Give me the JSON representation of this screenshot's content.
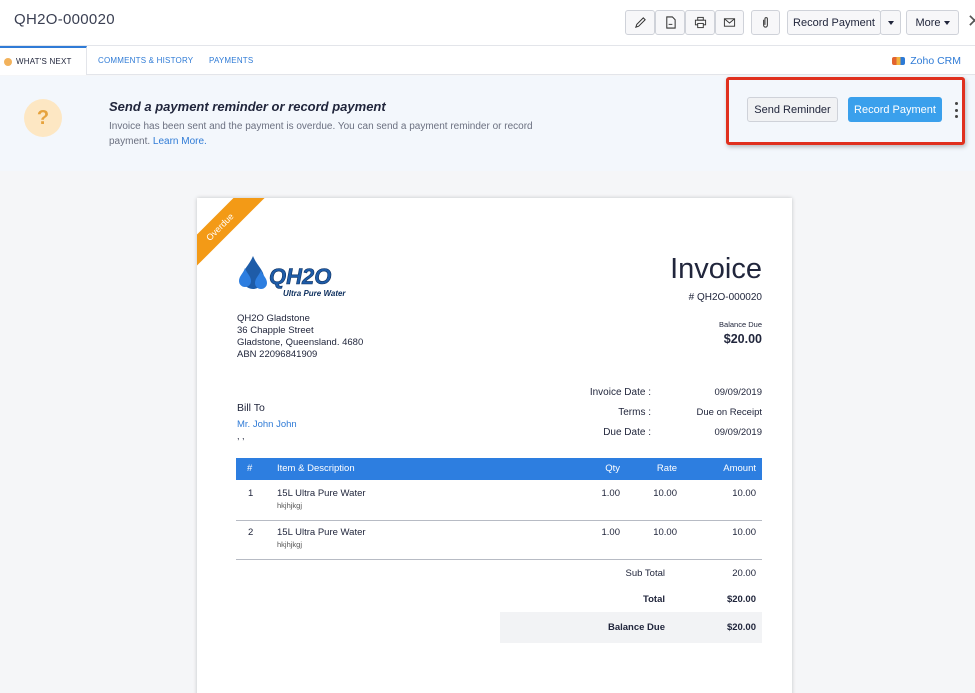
{
  "header": {
    "invoice_id": "QH2O-000020",
    "record_payment_label": "Record Payment",
    "more_label": "More",
    "close_glyph": "✕"
  },
  "tabs": [
    {
      "label": "WHAT'S NEXT"
    },
    {
      "label": "COMMENTS & HISTORY"
    },
    {
      "label": "PAYMENTS"
    }
  ],
  "crm_link": "Zoho CRM",
  "banner": {
    "title": "Send a payment reminder or record payment",
    "description": "Invoice has been sent and the payment is overdue. You can send a payment reminder or record payment.",
    "learn_more": "Learn More.",
    "send_reminder_label": "Send Reminder",
    "record_payment_label": "Record Payment",
    "icon": "question-bulb-icon"
  },
  "invoice": {
    "status_ribbon": "Overdue",
    "logo_text": "QH2O",
    "logo_tagline": "Ultra Pure Water",
    "heading": "Invoice",
    "number": "# QH2O-000020",
    "balance_due_label": "Balance Due",
    "balance_due_value": "$20.00",
    "company": {
      "line1": "QH2O Gladstone",
      "line2": "36 Chapple Street",
      "line3": "Gladstone, Queensland. 4680",
      "line4": "ABN 22096841909"
    },
    "meta": [
      {
        "label": "Invoice Date :",
        "value": "09/09/2019"
      },
      {
        "label": "Terms :",
        "value": "Due on Receipt"
      },
      {
        "label": "Due Date :",
        "value": "09/09/2019"
      }
    ],
    "bill_to_label": "Bill To",
    "customer": "Mr. John John",
    "customer_address": ", ,",
    "columns": [
      "#",
      "Item & Description",
      "Qty",
      "Rate",
      "Amount"
    ],
    "items": [
      {
        "num": "1",
        "name": "15L Ultra Pure Water",
        "desc": "hkjhjkgj",
        "qty": "1.00",
        "rate": "10.00",
        "amount": "10.00"
      },
      {
        "num": "2",
        "name": "15L Ultra Pure Water",
        "desc": "hkjhjkgj",
        "qty": "1.00",
        "rate": "10.00",
        "amount": "10.00"
      }
    ],
    "sub_total_label": "Sub Total",
    "sub_total_value": "20.00",
    "total_label": "Total",
    "total_value": "$20.00",
    "balance_label": "Balance Due",
    "balance_value": "$20.00"
  },
  "colors": {
    "accent": "#2f7bd6",
    "primary_button": "#3aa0ec",
    "table_header": "#2d7ee0",
    "ribbon": "#f39a16",
    "highlight": "#e0301e"
  }
}
